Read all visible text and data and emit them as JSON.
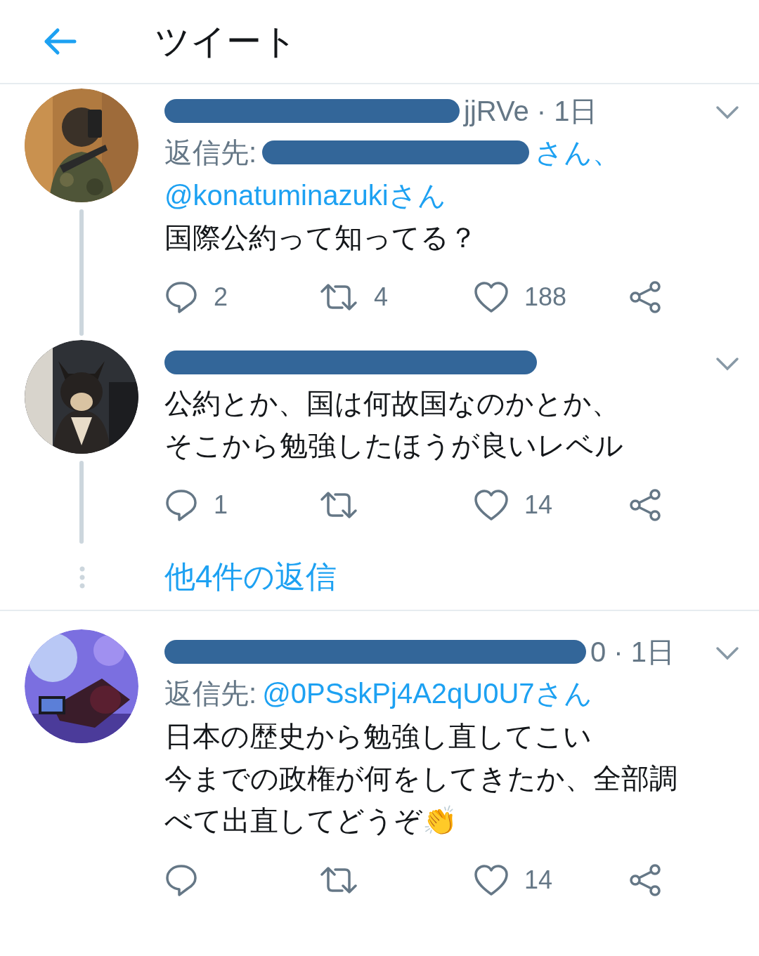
{
  "top_bar": {
    "title": "ツイート"
  },
  "tweets": [
    {
      "header_visible": "jjRVe · 1日",
      "reply_to": {
        "label": "返信先:",
        "tail": "さん、",
        "second": "@konatuminazukiさん"
      },
      "lines": [
        "国際公約って知ってる？"
      ],
      "thread_below": true,
      "actions": {
        "replies": "2",
        "retweets": "4",
        "likes": "188"
      }
    },
    {
      "lines": [
        "公約とか、国は何故国なのかとか、",
        "そこから勉強したほうが良いレベル"
      ],
      "thread_below": true,
      "more_replies": "他4件の返信",
      "actions": {
        "replies": "1",
        "likes": "14"
      }
    },
    {
      "header_visible": "0 · 1日",
      "reply_to": {
        "label": "返信先:",
        "first": "@0PSskPj4A2qU0U7さん"
      },
      "lines": [
        "日本の歴史から勉強し直してこい",
        "今までの政権が何をしてきたか、全部調",
        "べて出直してどうぞ👏"
      ],
      "thread_below": false,
      "actions": {
        "likes": "14"
      }
    }
  ]
}
